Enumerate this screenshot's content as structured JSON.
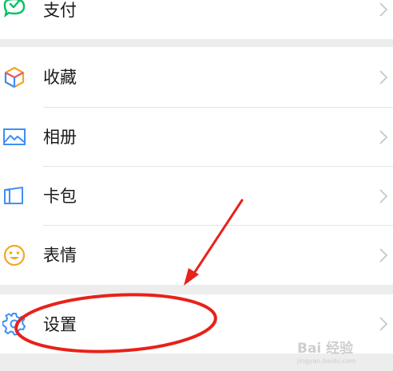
{
  "menu": {
    "items": [
      {
        "label": "支付",
        "icon": "wechat-pay-icon"
      },
      {
        "label": "收藏",
        "icon": "favorites-cube-icon"
      },
      {
        "label": "相册",
        "icon": "album-icon"
      },
      {
        "label": "卡包",
        "icon": "card-wallet-icon"
      },
      {
        "label": "表情",
        "icon": "sticker-smiley-icon"
      },
      {
        "label": "设置",
        "icon": "settings-gear-icon"
      }
    ]
  },
  "watermark": {
    "brand": "Bai 经验",
    "url": "jingyan.baidu.com"
  },
  "colors": {
    "background": "#ededed",
    "accent_green": "#07c160",
    "icon_blue": "#3f8ff7",
    "sticker_yellow": "#f5a623",
    "annotation_red": "#e8211a",
    "chevron": "#c7c7cc"
  }
}
